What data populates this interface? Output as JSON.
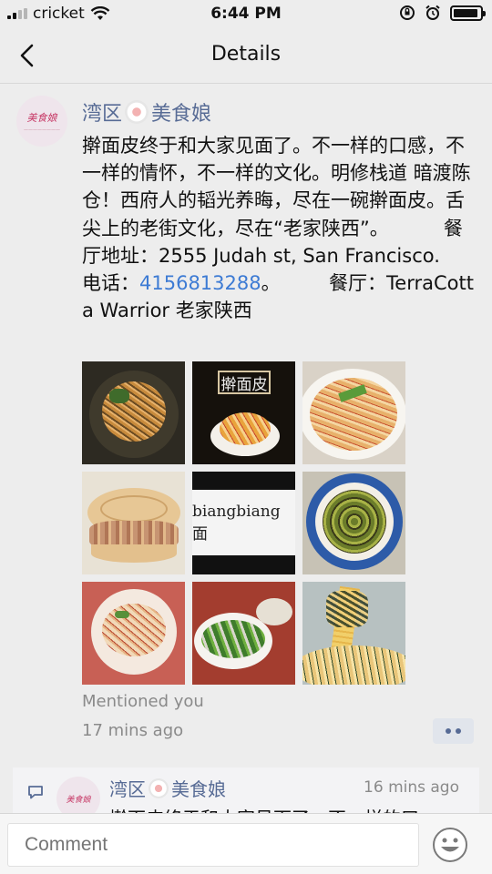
{
  "status_bar": {
    "carrier": "cricket",
    "time": "6:44 PM",
    "battery_level": 0.92
  },
  "nav": {
    "title": "Details",
    "back_icon": "chevron-left-icon"
  },
  "post": {
    "author_prefix": "湾区",
    "author_suffix": "美食娘",
    "avatar_text": "美食娘",
    "body_before_phone": "擀面皮终于和大家见面了。不一样的口感，不一样的情怀，不一样的文化。明修栈道 暗渡陈仓！西府人的韬光养晦，尽在一碗擀面皮。舌尖上的老街文化，尽在“老家陕西”。         餐厅地址：2555 Judah st, San Francisco.       电话：",
    "phone": "4156813288",
    "body_after_phone": "。        餐厅：TerraCotta Warrior 老家陕西",
    "photos": [
      {
        "kind": "noodles-dark"
      },
      {
        "kind": "sign",
        "caption": "擀面皮"
      },
      {
        "kind": "noodles-plate"
      },
      {
        "kind": "flatbread"
      },
      {
        "kind": "biangbiang",
        "caption": "biangbiang面"
      },
      {
        "kind": "soup-bowl"
      },
      {
        "kind": "bowl-pink"
      },
      {
        "kind": "greens"
      },
      {
        "kind": "noodle-lift"
      }
    ],
    "mentioned": "Mentioned you",
    "time_ago": "17 mins ago"
  },
  "comment": {
    "author_prefix": "湾区",
    "author_suffix": "美食娘",
    "avatar_text": "美食娘",
    "time": "16 mins ago",
    "text_preview": "擀面皮终于和大家见面了。不一样的口"
  },
  "compose": {
    "placeholder": "Comment",
    "emoji_icon": "smiley-icon"
  }
}
